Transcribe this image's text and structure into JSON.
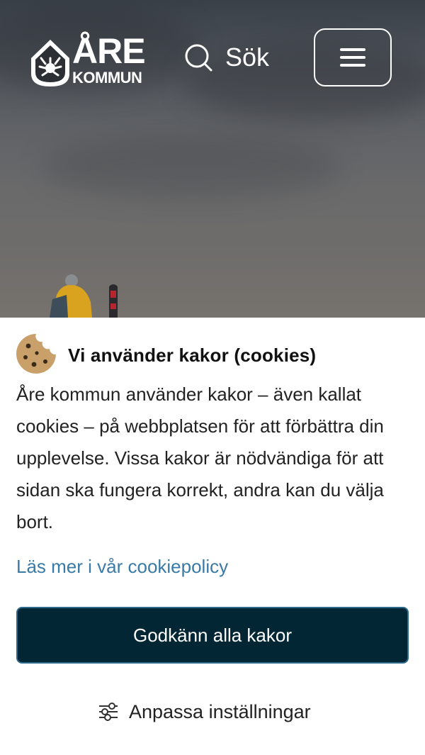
{
  "header": {
    "logo": {
      "line1": "ÅRE",
      "line2": "KOMMUN",
      "icon": "antler-shield-icon"
    },
    "search": {
      "label": "Sök",
      "icon": "search-icon"
    },
    "menu": {
      "icon": "hamburger-menu-icon"
    }
  },
  "cookie_banner": {
    "icon": "cookie-icon",
    "title": "Vi använder kakor (cookies)",
    "body": "Åre kommun använder kakor – även kallat cookies – på webbplatsen för att förbättra din upplevelse. Vissa kakor är nödvändiga för att sidan ska fungera korrekt, andra kan du välja bort.",
    "policy_link": "Läs mer i vår cookiepolicy",
    "accept_label": "Godkänn alla kakor",
    "settings_label": "Anpassa inställningar",
    "settings_icon": "sliders-icon"
  },
  "colors": {
    "accept_bg": "#032635",
    "accept_border": "#2d6a8c",
    "link": "#3a7aa7",
    "cookie": "#c9a06a"
  }
}
